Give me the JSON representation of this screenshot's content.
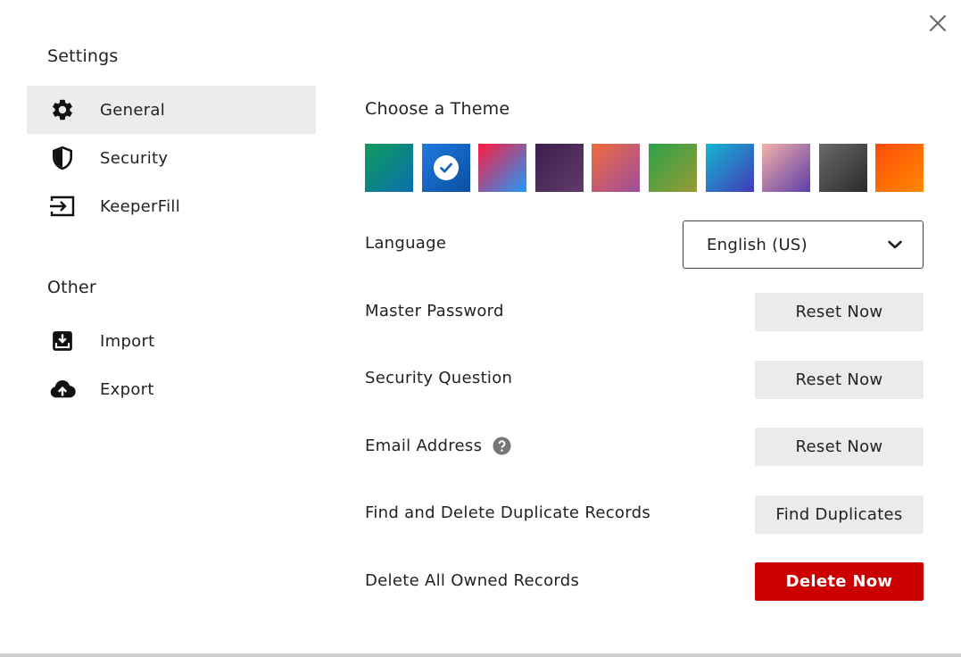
{
  "sidebar": {
    "settings_title": "Settings",
    "settings_items": [
      {
        "label": "General",
        "icon": "gear-icon",
        "active": true
      },
      {
        "label": "Security",
        "icon": "shield-icon",
        "active": false
      },
      {
        "label": "KeeperFill",
        "icon": "keeperfill-icon",
        "active": false
      }
    ],
    "other_title": "Other",
    "other_items": [
      {
        "label": "Import",
        "icon": "import-icon"
      },
      {
        "label": "Export",
        "icon": "cloud-upload-icon"
      }
    ]
  },
  "main": {
    "theme_title": "Choose a Theme",
    "themes": [
      {
        "from": "#0e9b5c",
        "to": "#0a6fae",
        "selected": false
      },
      {
        "from": "#1f7ae0",
        "to": "#0a4fa0",
        "selected": true
      },
      {
        "from": "#ff1a3c",
        "to": "#1e9bff",
        "selected": false
      },
      {
        "from": "#3c1f4f",
        "to": "#603a6a",
        "selected": false
      },
      {
        "from": "#f26a3c",
        "to": "#9a4f9f",
        "selected": false
      },
      {
        "from": "#2aa24a",
        "to": "#9a9a33",
        "selected": false
      },
      {
        "from": "#15b8d0",
        "to": "#4238b8",
        "selected": false
      },
      {
        "from": "#f4b0a8",
        "to": "#5c3da8",
        "selected": false
      },
      {
        "from": "#6a6a6a",
        "to": "#2a2a2a",
        "selected": false
      },
      {
        "from": "#ff4a0a",
        "to": "#ff8a00",
        "selected": false
      }
    ],
    "language": {
      "label": "Language",
      "value": "English (US)"
    },
    "rows": [
      {
        "label": "Master Password",
        "button": "Reset Now"
      },
      {
        "label": "Security Question",
        "button": "Reset Now"
      },
      {
        "label": "Email Address",
        "button": "Reset Now",
        "help": true
      },
      {
        "label": "Find and Delete Duplicate Records",
        "button": "Find Duplicates"
      },
      {
        "label": "Delete All Owned Records",
        "button": "Delete Now",
        "danger": true
      }
    ]
  },
  "colors": {
    "active_nav_bg": "#ececec",
    "button_bg": "#ebebeb",
    "danger": "#cc0000",
    "help_icon": "#777777"
  }
}
